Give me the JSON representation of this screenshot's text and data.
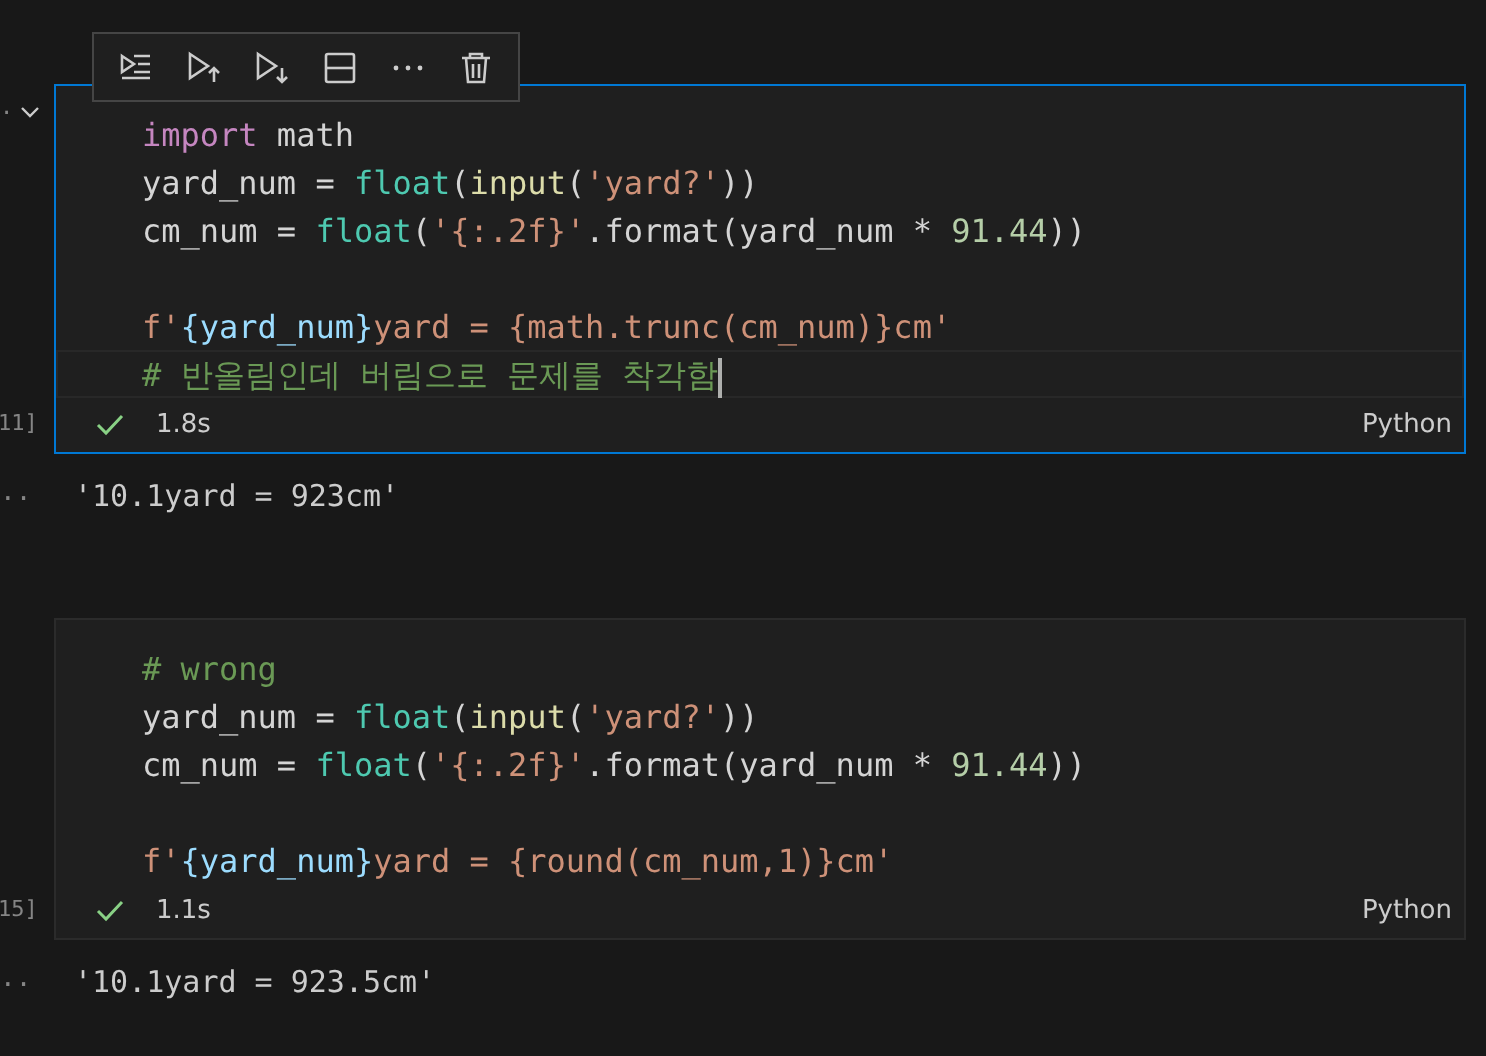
{
  "cells": [
    {
      "selected": true,
      "expanded": true,
      "gutter_mark": ".",
      "toolbar": [
        {
          "kind": "run-by-line"
        },
        {
          "kind": "execute-above"
        },
        {
          "kind": "execute-below"
        },
        {
          "kind": "split"
        },
        {
          "kind": "more"
        },
        {
          "kind": "delete"
        }
      ],
      "lines": [
        {
          "current": false,
          "tokens": [
            {
              "t": "import",
              "kind": "keyword"
            },
            {
              "t": " math",
              "kind": "plain"
            }
          ]
        },
        {
          "current": false,
          "tokens": [
            {
              "t": "yard_num = ",
              "kind": "plain"
            },
            {
              "t": "float",
              "kind": "class"
            },
            {
              "t": "(",
              "kind": "plain"
            },
            {
              "t": "input",
              "kind": "func"
            },
            {
              "t": "(",
              "kind": "plain"
            },
            {
              "t": "'yard?'",
              "kind": "string"
            },
            {
              "t": "))",
              "kind": "plain"
            }
          ]
        },
        {
          "current": false,
          "tokens": [
            {
              "t": "cm_num = ",
              "kind": "plain"
            },
            {
              "t": "float",
              "kind": "class"
            },
            {
              "t": "(",
              "kind": "plain"
            },
            {
              "t": "'{:.2f}'",
              "kind": "string"
            },
            {
              "t": ".format(yard_num * ",
              "kind": "plain"
            },
            {
              "t": "91.44",
              "kind": "number"
            },
            {
              "t": "))",
              "kind": "plain"
            }
          ]
        },
        {
          "current": false
        },
        {
          "current": false,
          "tokens": [
            {
              "t": "f'",
              "kind": "string"
            },
            {
              "t": "{yard_num}",
              "kind": "var"
            },
            {
              "t": "yard = {math.trunc(cm_num)}cm'",
              "kind": "string"
            }
          ]
        },
        {
          "current": true,
          "tokens": [
            {
              "t": "# 반올림인데 버림으로 문제를 착각함",
              "kind": "comment"
            }
          ]
        }
      ],
      "exec_count": "11]",
      "success": true,
      "duration": "1.8s",
      "language": "Python",
      "output_prompt": "..",
      "output": "'10.1yard = 923cm'"
    },
    {
      "selected": false,
      "lines": [
        {
          "current": false,
          "tokens": [
            {
              "t": "# wrong",
              "kind": "comment"
            }
          ]
        },
        {
          "current": false,
          "tokens": [
            {
              "t": "yard_num = ",
              "kind": "plain"
            },
            {
              "t": "float",
              "kind": "class"
            },
            {
              "t": "(",
              "kind": "plain"
            },
            {
              "t": "input",
              "kind": "func"
            },
            {
              "t": "(",
              "kind": "plain"
            },
            {
              "t": "'yard?'",
              "kind": "string"
            },
            {
              "t": "))",
              "kind": "plain"
            }
          ]
        },
        {
          "current": false,
          "tokens": [
            {
              "t": "cm_num = ",
              "kind": "plain"
            },
            {
              "t": "float",
              "kind": "class"
            },
            {
              "t": "(",
              "kind": "plain"
            },
            {
              "t": "'{:.2f}'",
              "kind": "string"
            },
            {
              "t": ".format(yard_num * ",
              "kind": "plain"
            },
            {
              "t": "91.44",
              "kind": "number"
            },
            {
              "t": "))",
              "kind": "plain"
            }
          ]
        },
        {
          "current": false
        },
        {
          "current": false,
          "tokens": [
            {
              "t": "f'",
              "kind": "string"
            },
            {
              "t": "{yard_num}",
              "kind": "var"
            },
            {
              "t": "yard = {round(cm_num,1)}cm'",
              "kind": "string"
            }
          ]
        }
      ],
      "exec_count": "15]",
      "success": true,
      "duration": "1.1s",
      "language": "Python",
      "output_prompt": "..",
      "output": "'10.1yard = 923.5cm'"
    }
  ]
}
